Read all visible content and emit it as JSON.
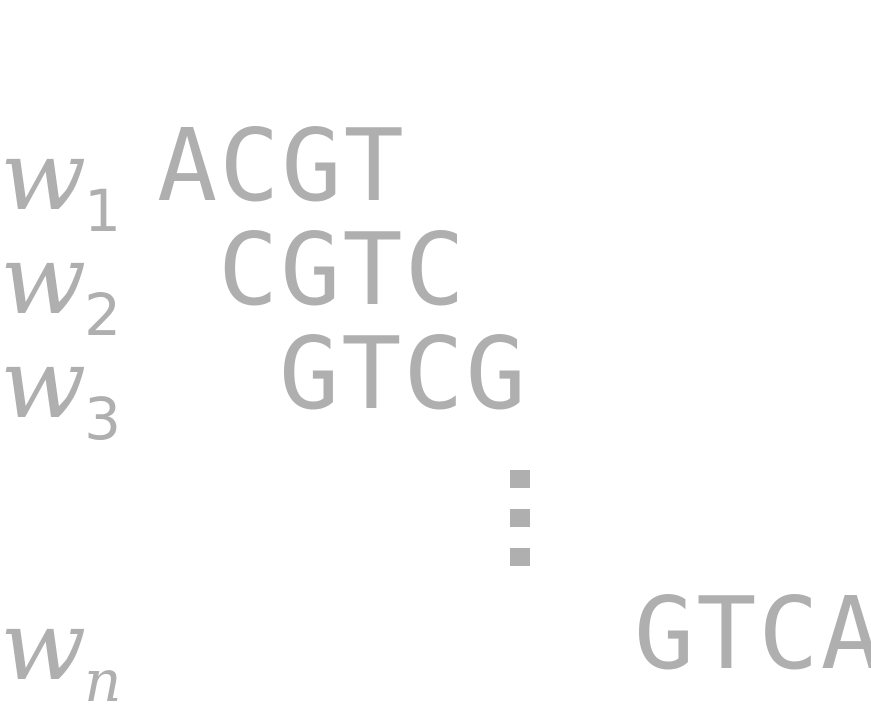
{
  "rows": [
    {
      "label": "w",
      "index": "1",
      "sequence": "ACGT"
    },
    {
      "label": "w",
      "index": "2",
      "sequence": "CGTC"
    },
    {
      "label": "w",
      "index": "3",
      "sequence": "GTCG"
    },
    {
      "label": "w",
      "index": "n",
      "sequence": "GTCA"
    }
  ],
  "ellipsis": "vertical-dots",
  "colors": {
    "text": "#afafaf",
    "background": "#ffffff"
  }
}
